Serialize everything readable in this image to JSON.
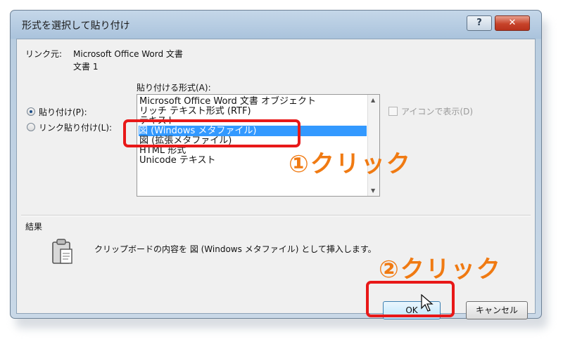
{
  "dialog": {
    "title": "形式を選択して貼り付け",
    "help_label": "?",
    "close_label": "✕"
  },
  "source": {
    "label": "リンク元:",
    "line1": "Microsoft Office Word 文書",
    "line2": "文書 1"
  },
  "options": {
    "paste_label": "貼り付け(P):",
    "paste_link_label": "リンク貼り付け(L):",
    "selected": "paste"
  },
  "format_list": {
    "label": "貼り付ける形式(A):",
    "items": [
      "Microsoft Office Word 文書 オブジェクト",
      "リッチ テキスト形式 (RTF)",
      "テキスト",
      "図 (Windows メタファイル)",
      "図 (拡張メタファイル)",
      "HTML 形式",
      "Unicode テキスト"
    ],
    "selected_index": 3
  },
  "display_as_icon": {
    "label": "アイコンで表示(D)",
    "checked": false
  },
  "result": {
    "label": "結果",
    "text": "クリップボードの内容を 図 (Windows メタファイル) として挿入します。",
    "icon": "clipboard-icon"
  },
  "buttons": {
    "ok": "OK",
    "cancel": "キャンセル"
  },
  "annotations": {
    "step1": "①クリック",
    "step2": "②クリック",
    "color": "#f07a12",
    "highlight_color": "#e81818"
  }
}
